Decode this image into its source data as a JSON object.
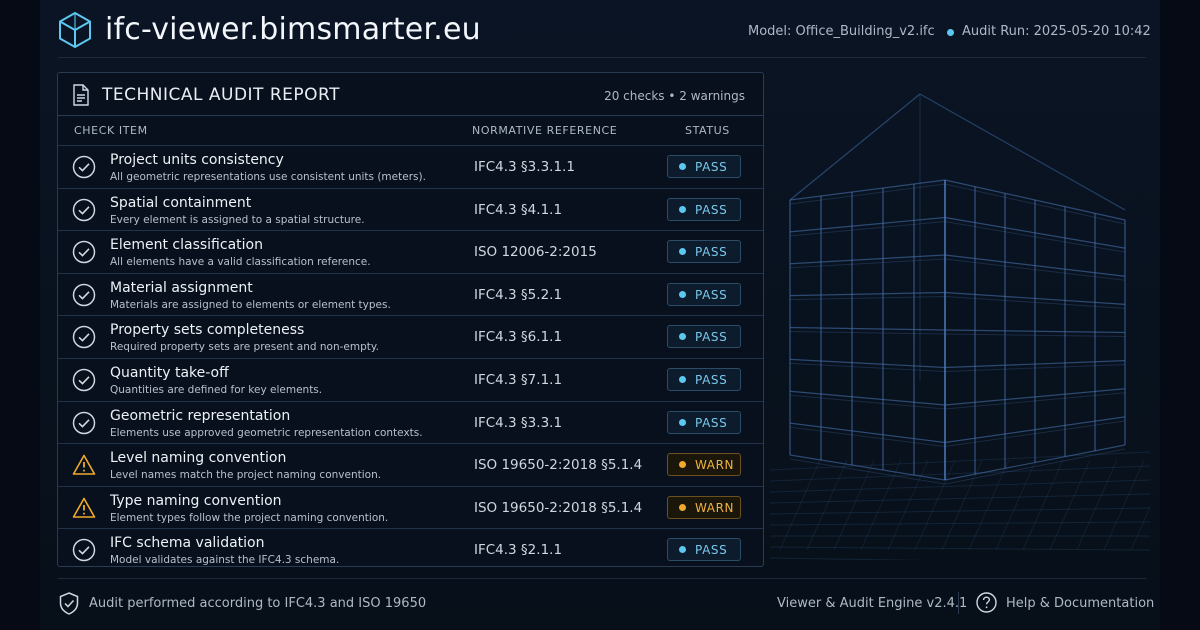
{
  "header": {
    "title": "ifc-viewer.bimsmarter.eu",
    "model": "Model: Office_Building_v2.ifc",
    "audit_run": "Audit Run: 2025-05-20 10:42"
  },
  "report": {
    "title": "TECHNICAL AUDIT REPORT",
    "stats": "20 checks  •  2 warnings",
    "columns": {
      "item": "CHECK ITEM",
      "reference": "NORMATIVE REFERENCE",
      "status": "STATUS"
    },
    "rows": [
      {
        "title": "Project units consistency",
        "desc": "All geometric representations use consistent units (meters).",
        "ref": "IFC4.3 §3.3.1.1",
        "status": "PASS"
      },
      {
        "title": "Spatial containment",
        "desc": "Every element is assigned to a spatial structure.",
        "ref": "IFC4.3 §4.1.1",
        "status": "PASS"
      },
      {
        "title": "Element classification",
        "desc": "All elements have a valid classification reference.",
        "ref": "ISO 12006-2:2015",
        "status": "PASS"
      },
      {
        "title": "Material assignment",
        "desc": "Materials are assigned to elements or element types.",
        "ref": "IFC4.3 §5.2.1",
        "status": "PASS"
      },
      {
        "title": "Property sets completeness",
        "desc": "Required property sets are present and non-empty.",
        "ref": "IFC4.3 §6.1.1",
        "status": "PASS"
      },
      {
        "title": "Quantity take-off",
        "desc": "Quantities are defined for key elements.",
        "ref": "IFC4.3 §7.1.1",
        "status": "PASS"
      },
      {
        "title": "Geometric representation",
        "desc": "Elements use approved geometric representation contexts.",
        "ref": "IFC4.3 §3.3.1",
        "status": "PASS"
      },
      {
        "title": "Level naming convention",
        "desc": "Level names match the project naming convention.",
        "ref": "ISO 19650-2:2018 §5.1.4",
        "status": "WARN"
      },
      {
        "title": "Type naming convention",
        "desc": "Element types follow the project naming convention.",
        "ref": "ISO 19650-2:2018 §5.1.4",
        "status": "WARN"
      },
      {
        "title": "IFC schema validation",
        "desc": "Model validates against the IFC4.3 schema.",
        "ref": "IFC4.3 §2.1.1",
        "status": "PASS"
      }
    ]
  },
  "footer": {
    "note": "Audit performed according to IFC4.3 and ISO 19650",
    "engine": "Viewer & Audit Engine v2.4.1",
    "help": "Help & Documentation"
  },
  "icons": {
    "logo": "isometric-cube-icon",
    "report": "document-icon",
    "pass": "check-circle-icon",
    "warn": "warning-triangle-icon",
    "footer_note": "shield-icon",
    "help": "question-circle-icon"
  },
  "colors": {
    "background": "#050a14",
    "accent": "#5cc8f0",
    "pass": "#79c9ee",
    "warn": "#f0b341",
    "building": "#4a78b8"
  }
}
